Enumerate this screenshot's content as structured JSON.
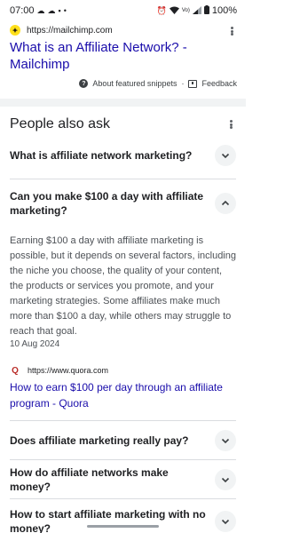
{
  "status_bar": {
    "time": "07:00",
    "battery": "100%"
  },
  "result": {
    "source_url": "https://mailchimp.com",
    "title": "What is an Affiliate Network? - Mailchimp",
    "about_snippets": "About featured snippets",
    "feedback": "Feedback"
  },
  "paa": {
    "heading": "People also ask",
    "q1": "What is affiliate network marketing?",
    "q2": "Can you make $100 a day with affiliate marketing?",
    "answer": {
      "text": "Earning $100 a day with affiliate marketing is possible, but it depends on several factors, including the niche you choose, the quality of your content, the products or services you promote, and your marketing strategies. Some affiliates make much more than $100 a day, while others may struggle to reach that goal.",
      "date": "10 Aug 2024",
      "source_url": "https://www.quora.com",
      "link_title": "How to earn $100 per day through an affiliate program - Quora"
    },
    "q3": "Does affiliate marketing really pay?",
    "q4": "How do affiliate networks make money?",
    "q5": "How to start affiliate marketing with no money?"
  },
  "icons": {
    "favicon": "mailchimp-favicon",
    "source_favicon": "quora-icon"
  },
  "colors": {
    "link": "#1a0dab",
    "text": "#202124",
    "muted": "#4d5156",
    "divider": "#f1f3f4"
  }
}
